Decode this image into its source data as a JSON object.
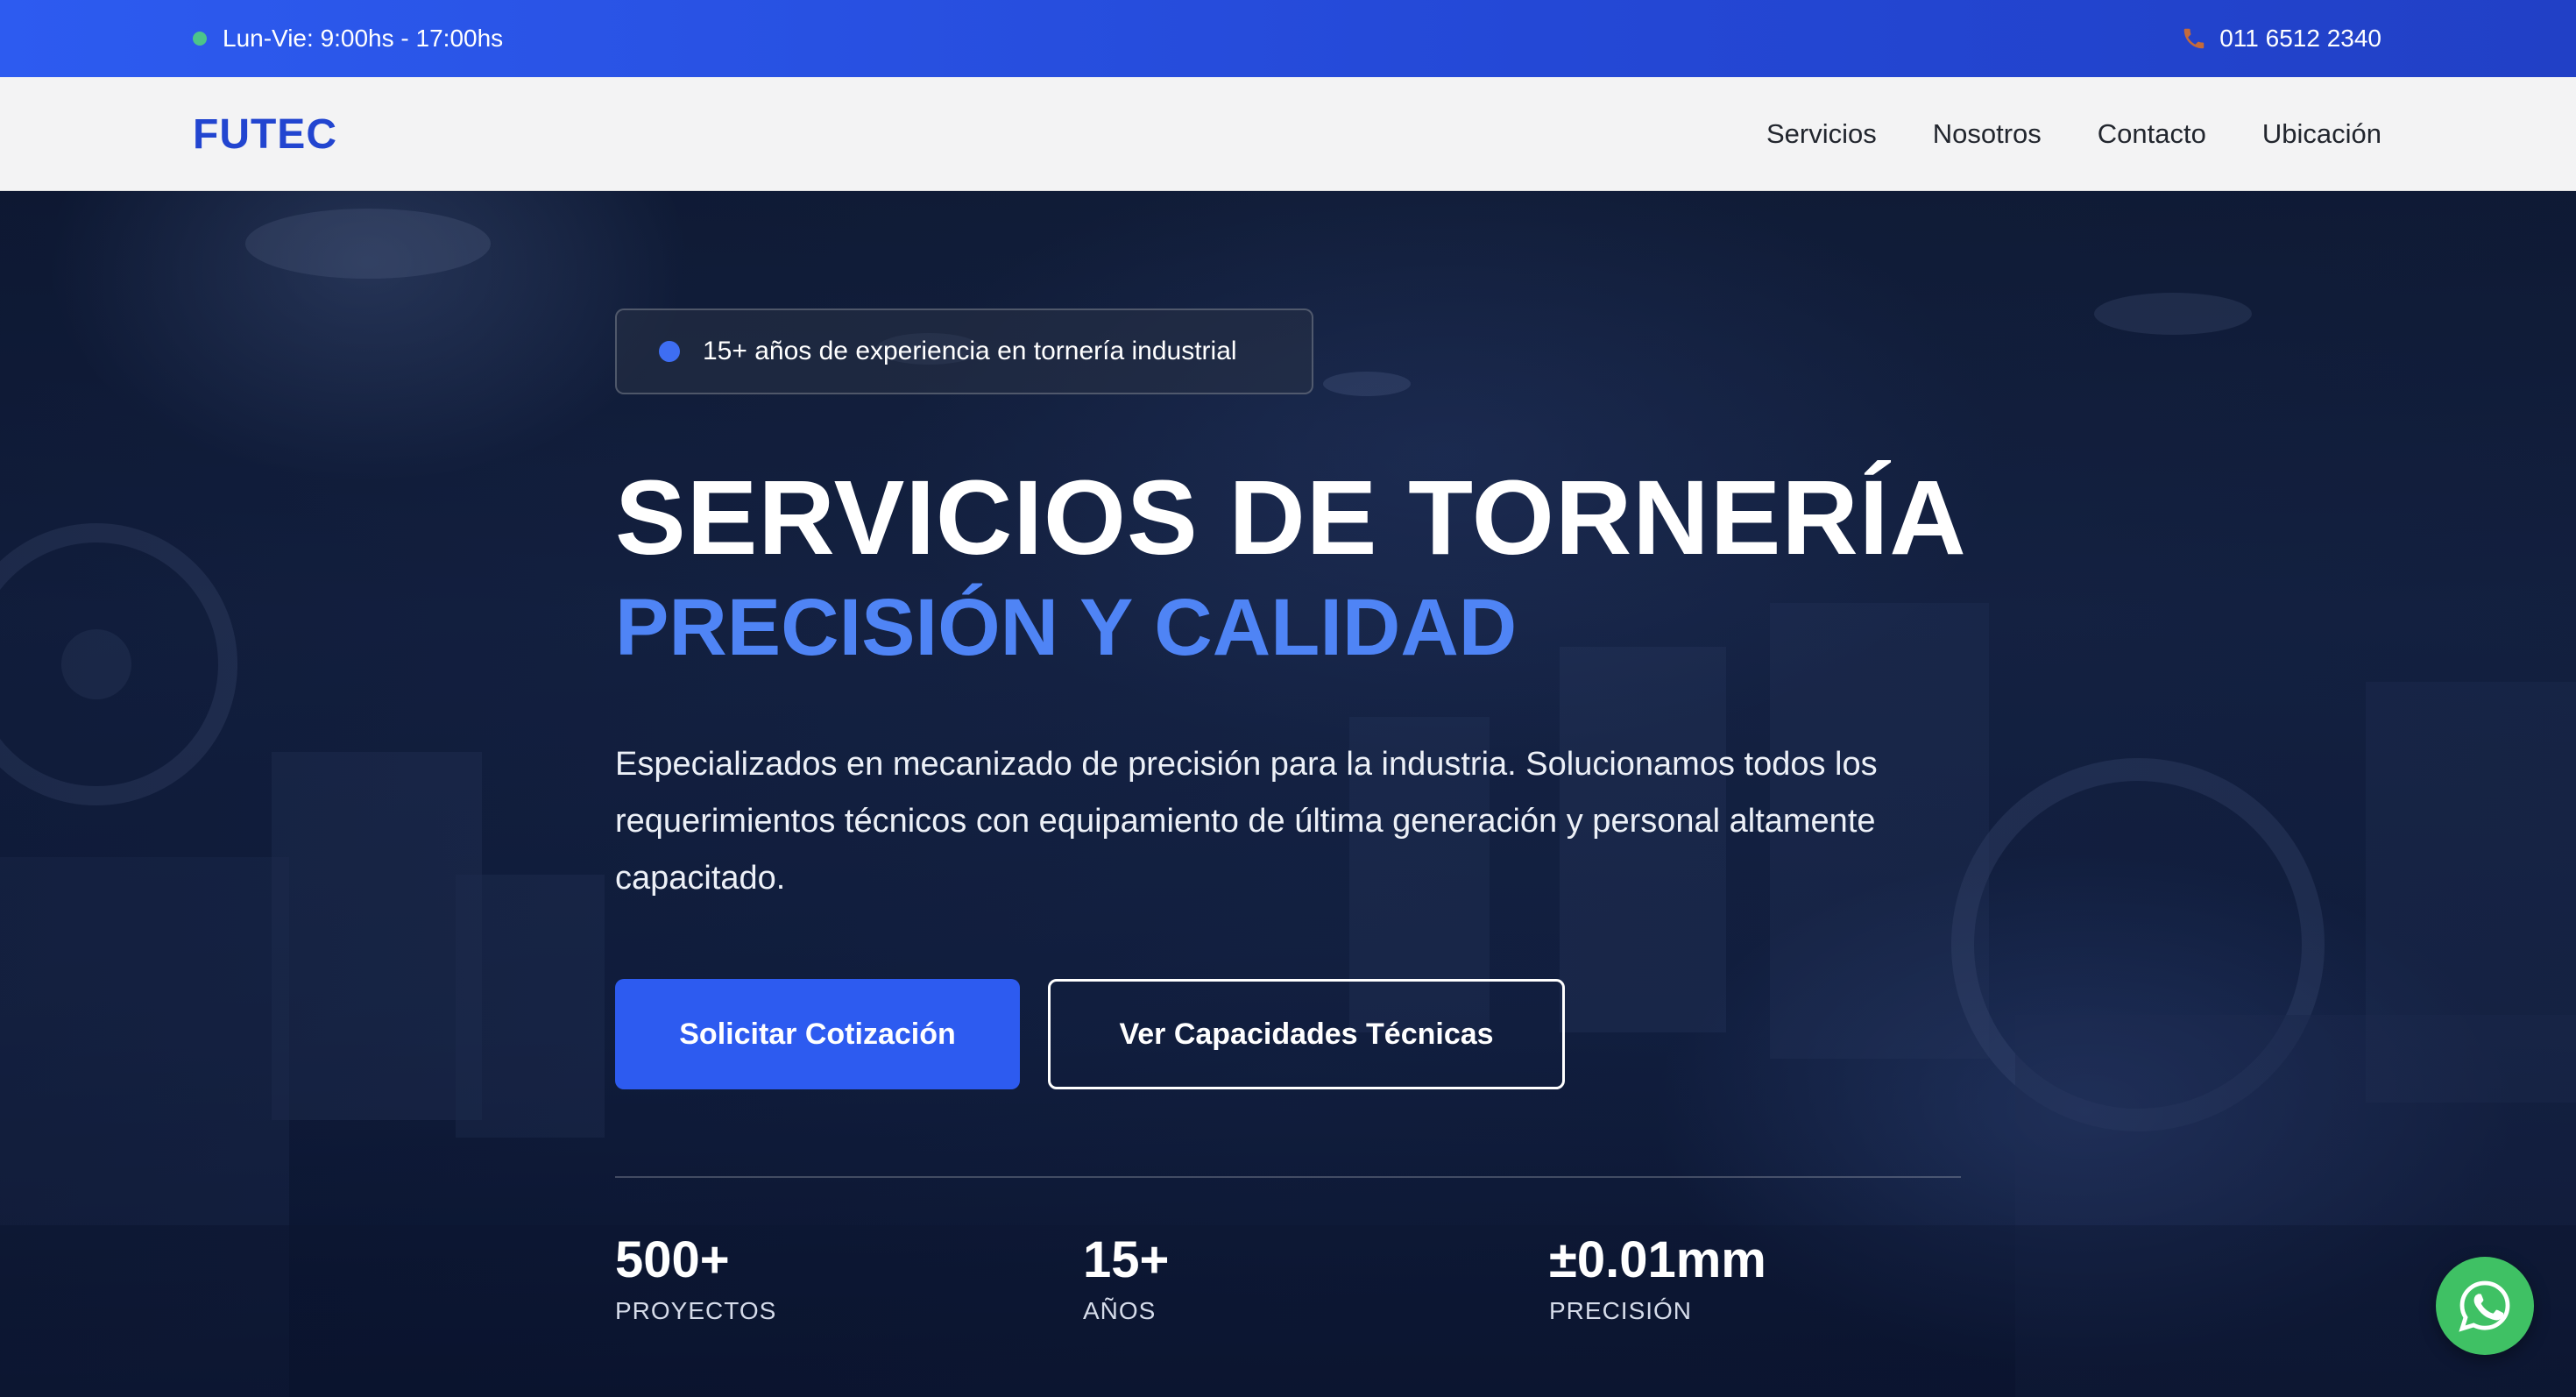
{
  "topbar": {
    "hours": "Lun-Vie: 9:00hs - 17:00hs",
    "phone": "011 6512 2340",
    "status_icon": "green-dot-icon",
    "phone_icon": "phone-icon"
  },
  "nav": {
    "brand": "FUTEC",
    "links": [
      "Servicios",
      "Nosotros",
      "Contacto",
      "Ubicación"
    ]
  },
  "hero": {
    "badge": "15+ años de experiencia en tornería industrial",
    "title": "SERVICIOS DE TORNERÍA",
    "subtitle": "PRECISIÓN Y CALIDAD",
    "description": "Especializados en mecanizado de precisión para la industria. Solucionamos todos los requerimientos técnicos con equipamiento de última generación y personal altamente capacitado.",
    "primary_button": "Solicitar Cotización",
    "secondary_button": "Ver Capacidades Técnicas"
  },
  "stats": [
    {
      "value": "500+",
      "label": "PROYECTOS"
    },
    {
      "value": "15+",
      "label": "AÑOS"
    },
    {
      "value": "±0.01mm",
      "label": "PRECISIÓN"
    }
  ],
  "floating": {
    "whatsapp_icon": "whatsapp-icon"
  },
  "colors": {
    "primary": "#2d5bf0",
    "brand": "#2245d0",
    "accent_text": "#4f84f5",
    "whatsapp": "#3fc164"
  }
}
